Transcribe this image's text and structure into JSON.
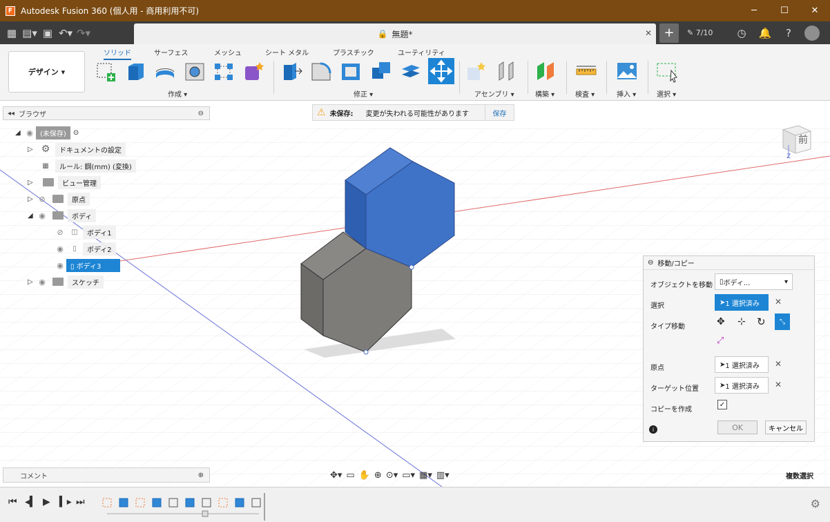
{
  "window": {
    "title": "Autodesk Fusion 360 (個人用 - 商用利用不可)",
    "logo_letter": "F"
  },
  "tabs": {
    "document": "無題*",
    "jobs": "7/10"
  },
  "ribbon": {
    "workspace": "デザイン",
    "tabs": [
      "ソリッド",
      "サーフェス",
      "メッシュ",
      "シート メタル",
      "プラスチック",
      "ユーティリティ"
    ],
    "groups": [
      "作成",
      "修正",
      "アセンブリ",
      "構築",
      "検査",
      "挿入",
      "選択"
    ]
  },
  "browser": {
    "title": "ブラウザ",
    "root": "(未保存)",
    "items": [
      "ドキュメントの設定",
      "ルール: 鋼(mm) (変換)",
      "ビュー管理",
      "原点",
      "ボディ",
      "ボディ1",
      "ボディ2",
      "ボディ3",
      "スケッチ"
    ]
  },
  "notice": {
    "label": "未保存:",
    "message": "変更が失われる可能性があります",
    "action": "保存"
  },
  "viewcube": {
    "face": "前",
    "axis": "Z"
  },
  "move_panel": {
    "title": "移動/コピー",
    "object_label": "オブジェクトを移動",
    "object_value": "ボディ...",
    "select_label": "選択",
    "select_value": "1 選択済み",
    "type_label": "タイプ移動",
    "origin_label": "原点",
    "origin_value": "1 選択済み",
    "target_label": "ターゲット位置",
    "target_value": "1 選択済み",
    "copy_label": "コピーを作成",
    "copy_checked": "✓",
    "ok": "OK",
    "cancel": "キャンセル"
  },
  "comments": {
    "label": "コメント"
  },
  "status": {
    "multi_select": "複数選択"
  },
  "colors": {
    "titlebar": "#7a4a12",
    "accent": "#1d85d4",
    "body_blue": "#3f73c8",
    "body_gray": "#7d7b78"
  }
}
